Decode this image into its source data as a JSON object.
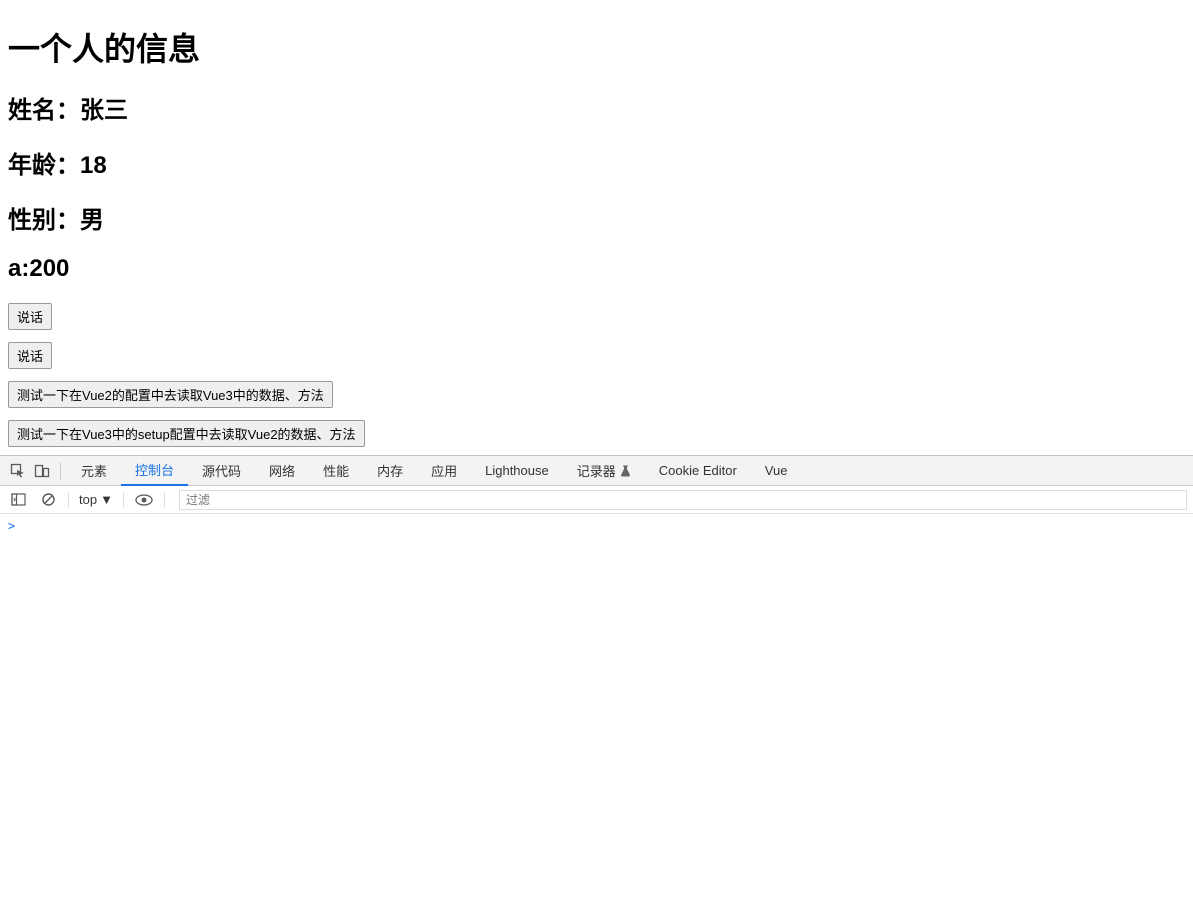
{
  "page": {
    "title": "一个人的信息",
    "name_line": "姓名：张三",
    "age_line": "年龄：18",
    "gender_line": "性别：男",
    "a_line": "a:200",
    "buttons": {
      "speak1": "说话",
      "speak2": "说话",
      "test_vue2_read_vue3": "测试一下在Vue2的配置中去读取Vue3中的数据、方法",
      "test_vue3_read_vue2": "测试一下在Vue3中的setup配置中去读取Vue2的数据、方法"
    }
  },
  "devtools": {
    "tabs": {
      "elements": "元素",
      "console": "控制台",
      "sources": "源代码",
      "network": "网络",
      "performance": "性能",
      "memory": "内存",
      "application": "应用",
      "lighthouse": "Lighthouse",
      "recorder": "记录器",
      "cookie_editor": "Cookie Editor",
      "vue": "Vue"
    },
    "subbar": {
      "context": "top",
      "filter_placeholder": "过滤"
    },
    "console": {
      "prompt": ">"
    }
  }
}
